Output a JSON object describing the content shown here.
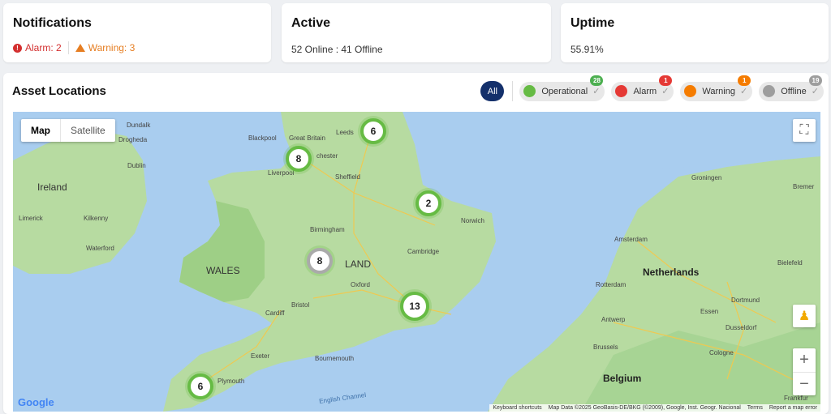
{
  "notifications": {
    "title": "Notifications",
    "alarm": "Alarm: 2",
    "warning": "Warning: 3"
  },
  "active": {
    "title": "Active",
    "text": "52 Online : 41 Offline"
  },
  "uptime": {
    "title": "Uptime",
    "text": "55.91%"
  },
  "assets": {
    "title": "Asset Locations",
    "all_label": "All",
    "filters": [
      {
        "label": "Operational",
        "count": "28",
        "color": "#66bb44",
        "badge": "#4caf50"
      },
      {
        "label": "Alarm",
        "count": "1",
        "color": "#e53935",
        "badge": "#e53935"
      },
      {
        "label": "Warning",
        "count": "1",
        "color": "#f57c00",
        "badge": "#f57c00"
      },
      {
        "label": "Offline",
        "count": "19",
        "color": "#9e9e9e",
        "badge": "#9e9e9e"
      }
    ]
  },
  "map": {
    "type_map": "Map",
    "type_satellite": "Satellite",
    "clusters": [
      "6",
      "8",
      "2",
      "8",
      "13",
      "6"
    ],
    "labels": {
      "ireland": "Ireland",
      "wales": "WALES",
      "netherlands": "Netherlands",
      "belgium": "Belgium",
      "dublin": "Dublin",
      "leeds": "Leeds",
      "sheffield": "Sheffield",
      "liverpool": "Liverpool",
      "manchester": "chester",
      "birmingham": "Birmingham",
      "norwich": "Norwich",
      "cambridge": "Cambridge",
      "oxford": "Oxford",
      "bristol": "Bristol",
      "cardiff": "Cardiff",
      "plymouth": "Plymouth",
      "exeter": "Exeter",
      "bournemouth": "Bournemouth",
      "amsterdam": "Amsterdam",
      "rotterdam": "Rotterdam",
      "antwerp": "Antwerp",
      "brussels": "Brussels",
      "essen": "Essen",
      "dortmund": "Dortmund",
      "dusseldorf": "Dusseldorf",
      "cologne": "Cologne",
      "bielefeld": "Bielefeld",
      "groningen": "Groningen",
      "bremen": "Bremer",
      "frankfurt": "Frankfur",
      "england": "LAND",
      "english_channel": "English Channel",
      "limerick": "Limerick",
      "kilkenny": "Kilkenny",
      "waterford": "Waterford",
      "blackpool": "Blackpool",
      "great_britain": "Great Britain",
      "drogheda": "Drogheda",
      "dundalk": "Dundalk"
    },
    "attribution": {
      "shortcuts": "Keyboard shortcuts",
      "data": "Map Data ©2025 GeoBasis-DE/BKG (©2009), Google, Inst. Geogr. Nacional",
      "terms": "Terms",
      "report": "Report a map error"
    },
    "google": "Google",
    "zoom_in": "+",
    "zoom_out": "−"
  }
}
